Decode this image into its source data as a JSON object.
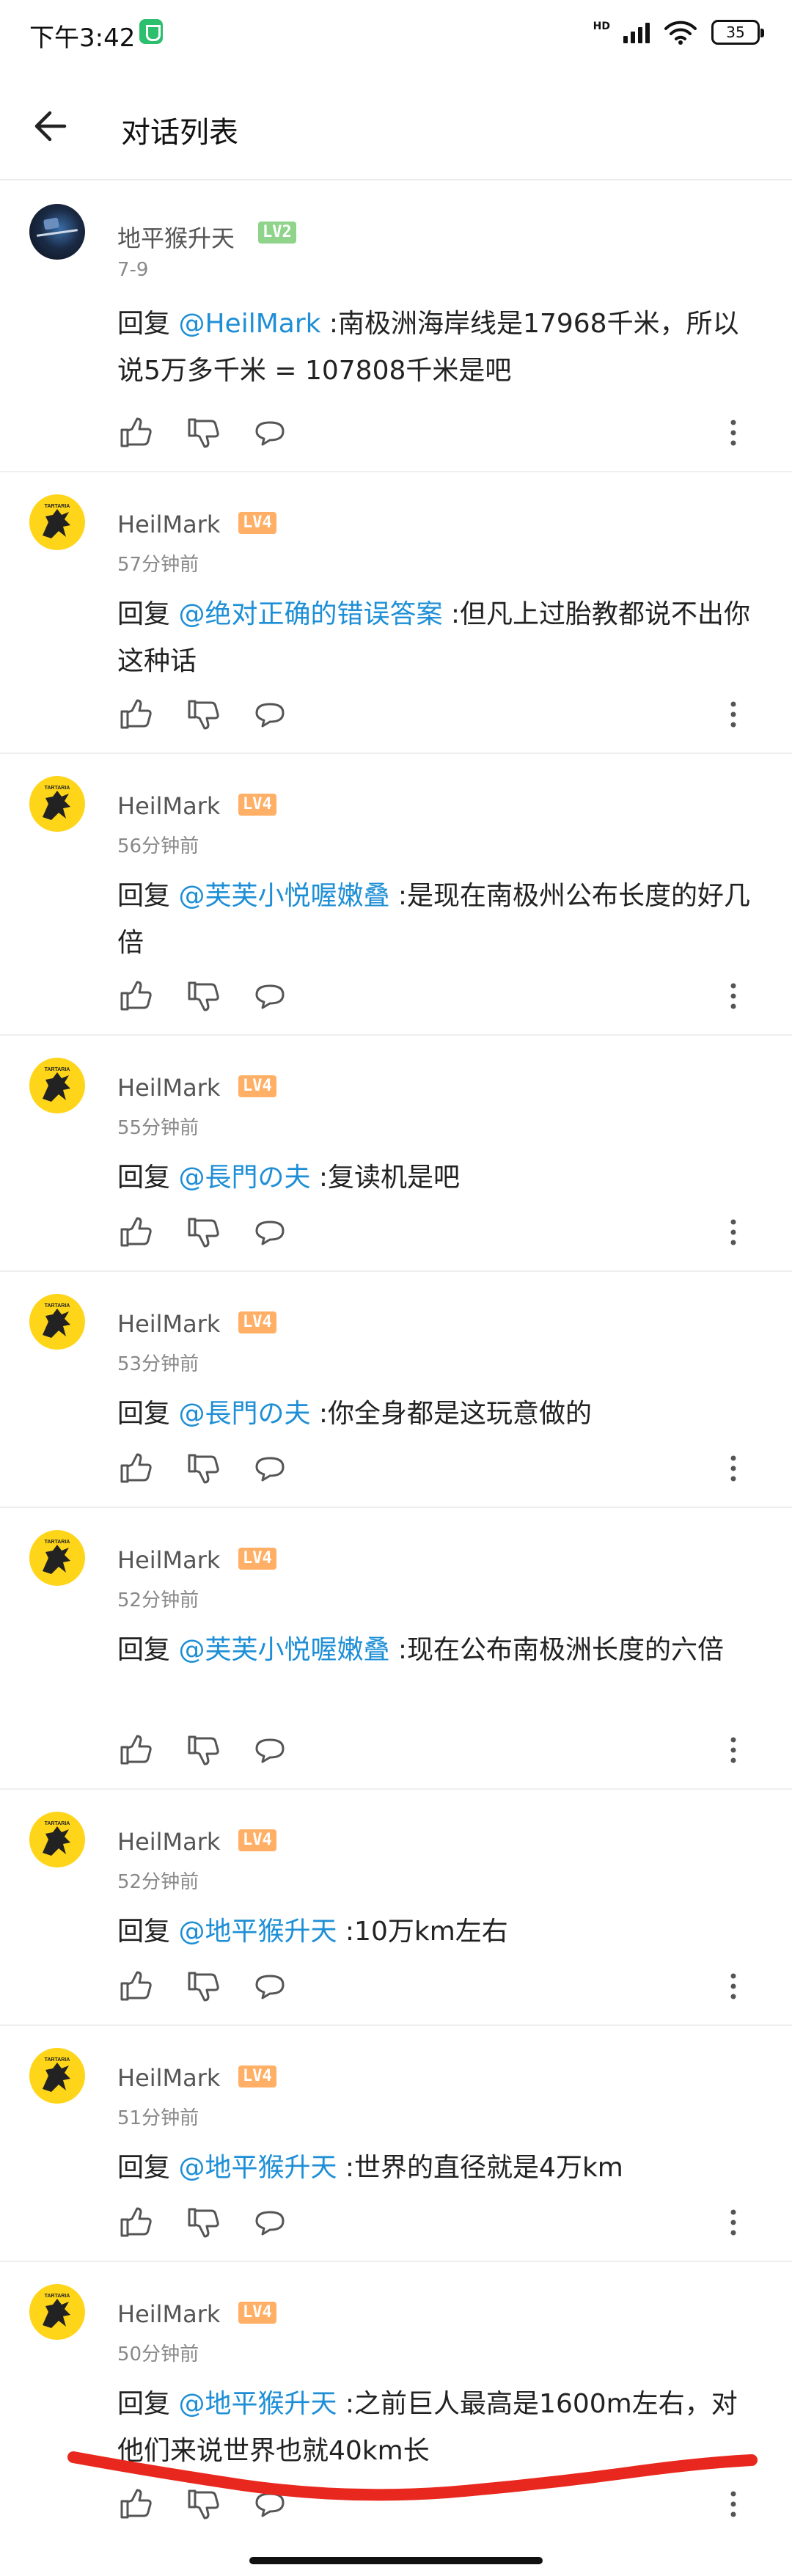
{
  "status_bar": {
    "time": "下午3:42",
    "hd": "HD",
    "battery": "35"
  },
  "header": {
    "title": "对话列表"
  },
  "comments": [
    {
      "user": "地平猴升天",
      "level": "LV2",
      "time": "7-9",
      "reply_prefix": "回复",
      "mention": "@HeilMark",
      "text": " :南极洲海岸线是17968千米，所以说5万多千米 = 107808千米是吧"
    },
    {
      "user": "HeilMark",
      "level": "LV4",
      "time": "57分钟前",
      "reply_prefix": "回复",
      "mention": "@绝对正确的错误答案",
      "text": " :但凡上过胎教都说不出你这种话"
    },
    {
      "user": "HeilMark",
      "level": "LV4",
      "time": "56分钟前",
      "reply_prefix": "回复",
      "mention": "@芙芙小悦喔嫩叠",
      "text": " :是现在南极州公布长度的好几倍"
    },
    {
      "user": "HeilMark",
      "level": "LV4",
      "time": "55分钟前",
      "reply_prefix": "回复",
      "mention": "@長門の夫",
      "text": " :复读机是吧"
    },
    {
      "user": "HeilMark",
      "level": "LV4",
      "time": "53分钟前",
      "reply_prefix": "回复",
      "mention": "@長門の夫",
      "text": " :你全身都是这玩意做的"
    },
    {
      "user": "HeilMark",
      "level": "LV4",
      "time": "52分钟前",
      "reply_prefix": "回复",
      "mention": "@芙芙小悦喔嫩叠",
      "text": " :现在公布南极洲长度的六倍"
    },
    {
      "user": "HeilMark",
      "level": "LV4",
      "time": "52分钟前",
      "reply_prefix": "回复",
      "mention": "@地平猴升天",
      "text": " :10万km左右"
    },
    {
      "user": "HeilMark",
      "level": "LV4",
      "time": "51分钟前",
      "reply_prefix": "回复",
      "mention": "@地平猴升天",
      "text": " :世界的直径就是4万km"
    },
    {
      "user": "HeilMark",
      "level": "LV4",
      "time": "50分钟前",
      "reply_prefix": "回复",
      "mention": "@地平猴升天",
      "text": " :之前巨人最高是1600m左右，对他们来说世界也就40km长"
    }
  ],
  "colors": {
    "mention": "#1e8fd6",
    "lv2": "#8fd48a",
    "lv4": "#ffb066",
    "annotation": "#e8281e"
  },
  "icons": [
    "back-arrow-icon",
    "thumb-up-icon",
    "thumb-down-icon",
    "comment-bubble-icon",
    "more-vertical-icon",
    "security-shield-icon",
    "signal-icon",
    "wifi-icon",
    "battery-icon"
  ]
}
